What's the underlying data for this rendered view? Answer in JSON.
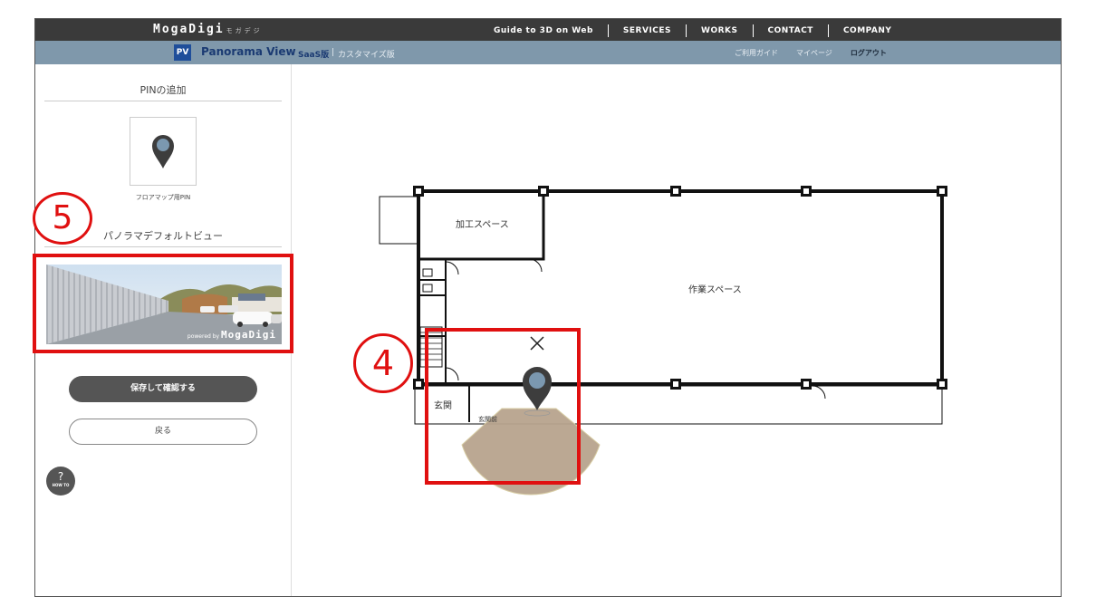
{
  "topbar": {
    "logo": "MogaDigi",
    "logo_sub": "モガデジ",
    "nav": [
      "Guide to 3D on Web",
      "SERVICES",
      "WORKS",
      "CONTACT",
      "COMPANY"
    ]
  },
  "subbar": {
    "badge": "PV",
    "title": "Panorama View",
    "plan_saas": "SaaS版",
    "plan_sep": "|",
    "plan_custom": "カスタマイズ版",
    "nav": [
      "ご利用ガイド",
      "マイページ",
      "ログアウト"
    ]
  },
  "sidebar": {
    "pin_section_title": "PINの追加",
    "pin_caption": "フロアマップ用PIN",
    "default_view_title": "パノラマデフォルトビュー",
    "thumbnail_credit_prefix": "powered by",
    "thumbnail_credit_brand": "MogaDigi",
    "save_button": "保存して確認する",
    "back_button": "戻る",
    "help_button": "?",
    "help_sub": "HOW TO"
  },
  "floorplan": {
    "rooms": [
      "加工スペース",
      "作業スペース",
      "玄関"
    ],
    "pin_label": "玄関前",
    "close_mark": "×"
  },
  "annotations": {
    "marker_4": "4",
    "marker_5": "5"
  },
  "colors": {
    "accent_red": "#e01010",
    "subbar": "#7f98ab",
    "topbar": "#3a3a3a",
    "pin": "#3d3d3d",
    "pin_dot": "#7b98b0",
    "view_cone": "#b8a48e"
  }
}
